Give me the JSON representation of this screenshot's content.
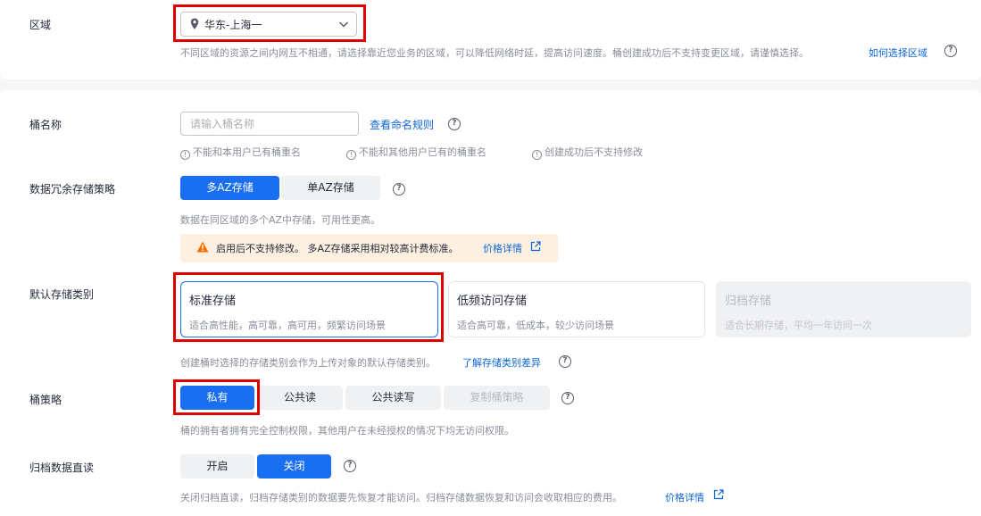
{
  "region": {
    "label": "区域",
    "value": "华东-上海一",
    "hint": "不同区域的资源之间内网互不相通，请选择靠近您业务的区域，可以降低网络时延，提高访问速度。桶创建成功后不支持变更区域，请谨慎选择。",
    "link": "如何选择区域"
  },
  "bucket_name": {
    "label": "桶名称",
    "placeholder": "请输入桶名称",
    "link": "查看命名规则",
    "rules": [
      "不能和本用户已有桶重名",
      "不能和其他用户已有的桶重名",
      "创建成功后不支持修改"
    ]
  },
  "redundancy": {
    "label": "数据冗余存储策略",
    "options": [
      "多AZ存储",
      "单AZ存储"
    ],
    "selected": "多AZ存储",
    "hint": "数据在同区域的多个AZ中存储，可用性更高。",
    "warning": "启用后不支持修改。 多AZ存储采用相对较高计费标准。",
    "warning_link": "价格详情"
  },
  "storage_class": {
    "label": "默认存储类别",
    "cards": [
      {
        "title": "标准存储",
        "desc": "适合高性能，高可靠，高可用，频繁访问场景",
        "state": "selected"
      },
      {
        "title": "低频访问存储",
        "desc": "适合高可靠，低成本，较少访问场景",
        "state": "normal"
      },
      {
        "title": "归档存储",
        "desc": "适合长期存储，平均一年访问一次",
        "state": "disabled"
      }
    ],
    "hint": "创建桶时选择的存储类别会作为上传对象的默认存储类别。",
    "link": "了解存储类别差异"
  },
  "policy": {
    "label": "桶策略",
    "options": [
      "私有",
      "公共读",
      "公共读写",
      "复制桶策略"
    ],
    "selected": "私有",
    "hint": "桶的拥有者拥有完全控制权限，其他用户在未经授权的情况下均无访问权限。"
  },
  "archive_read": {
    "label": "归档数据直读",
    "options": [
      "开启",
      "关闭"
    ],
    "selected": "关闭",
    "hint": "关闭归档直读，归档存储类别的数据要先恢复才能访问。归档存储数据恢复和访问会收取相应的费用。",
    "link": "价格详情"
  },
  "colors": {
    "primary": "#1a6ff0",
    "link": "#0d66d9",
    "highlight": "#e00000",
    "warning_bg": "#fdf0e1"
  }
}
